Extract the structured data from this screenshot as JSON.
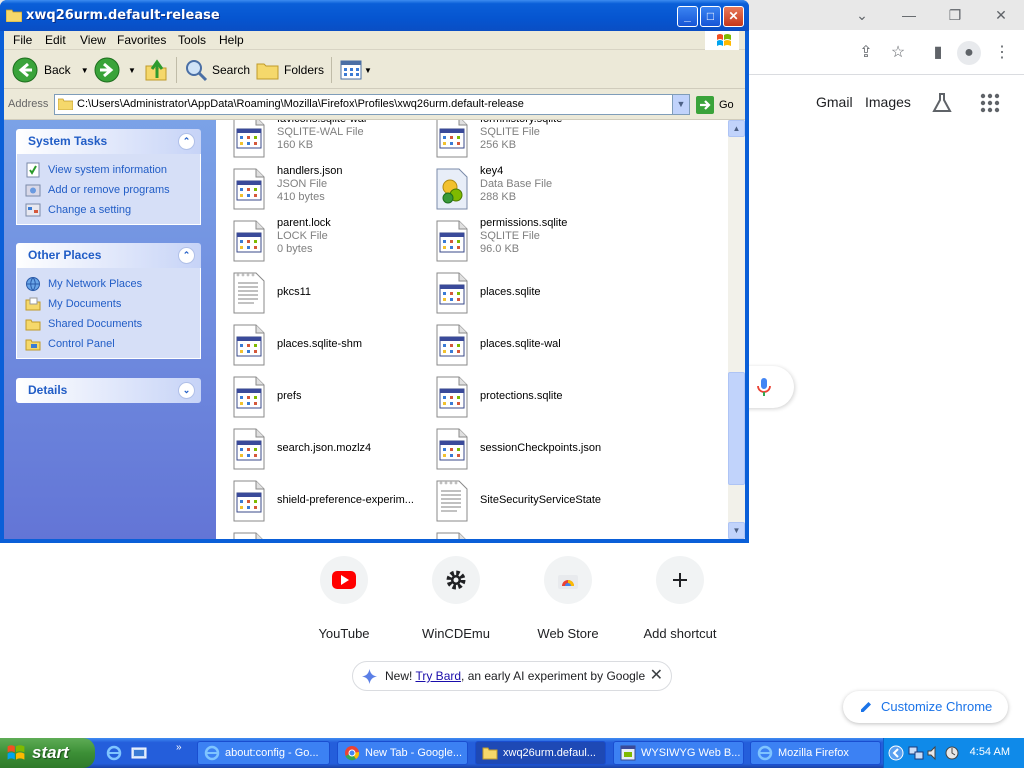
{
  "chrome": {
    "top_links": [
      "Gmail",
      "Images"
    ],
    "shortcuts": [
      {
        "label": "YouTube",
        "icon": "youtube-icon"
      },
      {
        "label": "WinCDEmu",
        "icon": "gear-icon"
      },
      {
        "label": "Web Store",
        "icon": "chrome-webstore-icon"
      },
      {
        "label": "Add shortcut",
        "icon": "plus-icon"
      }
    ],
    "bard": {
      "prefix": "New!",
      "link": "Try Bard",
      "suffix": ", an early AI experiment by Google"
    },
    "customize_label": "Customize Chrome"
  },
  "explorer": {
    "title": "xwq26urm.default-release",
    "menu": [
      "File",
      "Edit",
      "View",
      "Favorites",
      "Tools",
      "Help"
    ],
    "toolbar": {
      "back": "Back",
      "search": "Search",
      "folders": "Folders"
    },
    "address": {
      "label": "Address",
      "path": "C:\\Users\\Administrator\\AppData\\Roaming\\Mozilla\\Firefox\\Profiles\\xwq26urm.default-release",
      "go": "Go"
    },
    "system_tasks": {
      "title": "System Tasks",
      "items": [
        "View system information",
        "Add or remove programs",
        "Change a setting"
      ]
    },
    "other_places": {
      "title": "Other Places",
      "items": [
        "My Network Places",
        "My Documents",
        "Shared Documents",
        "Control Panel"
      ]
    },
    "details": {
      "title": "Details"
    },
    "files": [
      {
        "name": "favicons.sqlite-wal",
        "type": "SQLITE-WAL File",
        "size": "160 KB",
        "icon": "app-file-icon"
      },
      {
        "name": "formhistory.sqlite",
        "type": "SQLITE File",
        "size": "256 KB",
        "icon": "app-file-icon"
      },
      {
        "name": "handlers.json",
        "type": "JSON File",
        "size": "410 bytes",
        "icon": "app-file-icon"
      },
      {
        "name": "key4",
        "type": "Data Base File",
        "size": "288 KB",
        "icon": "database-file-icon"
      },
      {
        "name": "parent.lock",
        "type": "LOCK File",
        "size": "0 bytes",
        "icon": "app-file-icon"
      },
      {
        "name": "permissions.sqlite",
        "type": "SQLITE File",
        "size": "96.0 KB",
        "icon": "app-file-icon"
      },
      {
        "name": "pkcs11",
        "type": "",
        "size": "",
        "icon": "text-file-icon"
      },
      {
        "name": "places.sqlite",
        "type": "",
        "size": "",
        "icon": "app-file-icon"
      },
      {
        "name": "places.sqlite-shm",
        "type": "",
        "size": "",
        "icon": "app-file-icon"
      },
      {
        "name": "places.sqlite-wal",
        "type": "",
        "size": "",
        "icon": "app-file-icon"
      },
      {
        "name": "prefs",
        "type": "",
        "size": "",
        "icon": "app-file-icon"
      },
      {
        "name": "protections.sqlite",
        "type": "",
        "size": "",
        "icon": "app-file-icon"
      },
      {
        "name": "search.json.mozlz4",
        "type": "",
        "size": "",
        "icon": "app-file-icon"
      },
      {
        "name": "sessionCheckpoints.json",
        "type": "",
        "size": "",
        "icon": "app-file-icon"
      },
      {
        "name": "shield-preference-experim...",
        "type": "",
        "size": "",
        "icon": "app-file-icon"
      },
      {
        "name": "SiteSecurityServiceState",
        "type": "",
        "size": "",
        "icon": "text-file-icon"
      }
    ]
  },
  "taskbar": {
    "start": "start",
    "tasks": [
      {
        "label": "about:config - Go...",
        "icon": "ie-icon",
        "active": false
      },
      {
        "label": "New Tab - Google...",
        "icon": "chrome-icon",
        "active": false
      },
      {
        "label": "xwq26urm.defaul...",
        "icon": "folder-icon",
        "active": true
      },
      {
        "label": "WYSIWYG Web B...",
        "icon": "app-window-icon",
        "active": false
      },
      {
        "label": "Mozilla Firefox",
        "icon": "ie-icon",
        "active": false
      }
    ],
    "clock": "4:54 AM"
  },
  "colors": {
    "xp_blue": "#0a5fd8",
    "taskpane_link": "#215dc6",
    "start_green": "#3c8f36",
    "chrome_accent": "#1a73e8"
  }
}
